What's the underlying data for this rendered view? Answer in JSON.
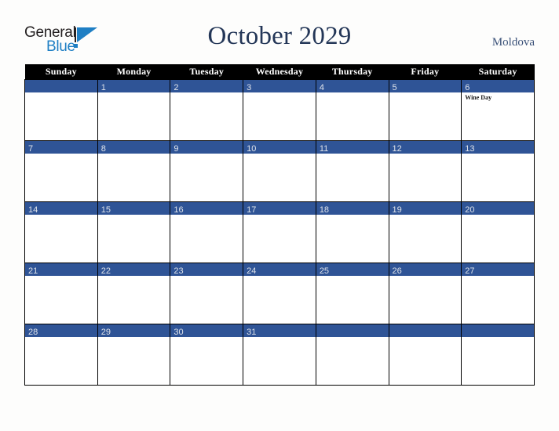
{
  "brand": {
    "name_part1": "General",
    "name_part2": "Blue",
    "triangle_color": "#1f7fc4",
    "text_color": "#231f20"
  },
  "header": {
    "title": "October 2029",
    "country": "Moldova",
    "title_color": "#233657",
    "country_color": "#3b5279"
  },
  "calendar": {
    "weekday_headers": [
      "Sunday",
      "Monday",
      "Tuesday",
      "Wednesday",
      "Thursday",
      "Friday",
      "Saturday"
    ],
    "header_bg": "#000000",
    "header_text_color": "#ffffff",
    "date_bar_color": "#2f5496",
    "date_text_color": "#dfe3ea",
    "cell_bg": "#ffffff",
    "grid_line_color": "#000000",
    "weeks": [
      [
        {
          "day": "",
          "events": []
        },
        {
          "day": "1",
          "events": []
        },
        {
          "day": "2",
          "events": []
        },
        {
          "day": "3",
          "events": []
        },
        {
          "day": "4",
          "events": []
        },
        {
          "day": "5",
          "events": []
        },
        {
          "day": "6",
          "events": [
            "Wine Day"
          ]
        }
      ],
      [
        {
          "day": "7",
          "events": []
        },
        {
          "day": "8",
          "events": []
        },
        {
          "day": "9",
          "events": []
        },
        {
          "day": "10",
          "events": []
        },
        {
          "day": "11",
          "events": []
        },
        {
          "day": "12",
          "events": []
        },
        {
          "day": "13",
          "events": []
        }
      ],
      [
        {
          "day": "14",
          "events": []
        },
        {
          "day": "15",
          "events": []
        },
        {
          "day": "16",
          "events": []
        },
        {
          "day": "17",
          "events": []
        },
        {
          "day": "18",
          "events": []
        },
        {
          "day": "19",
          "events": []
        },
        {
          "day": "20",
          "events": []
        }
      ],
      [
        {
          "day": "21",
          "events": []
        },
        {
          "day": "22",
          "events": []
        },
        {
          "day": "23",
          "events": []
        },
        {
          "day": "24",
          "events": []
        },
        {
          "day": "25",
          "events": []
        },
        {
          "day": "26",
          "events": []
        },
        {
          "day": "27",
          "events": []
        }
      ],
      [
        {
          "day": "28",
          "events": []
        },
        {
          "day": "29",
          "events": []
        },
        {
          "day": "30",
          "events": []
        },
        {
          "day": "31",
          "events": []
        },
        {
          "day": "",
          "events": []
        },
        {
          "day": "",
          "events": []
        },
        {
          "day": "",
          "events": []
        }
      ]
    ]
  }
}
